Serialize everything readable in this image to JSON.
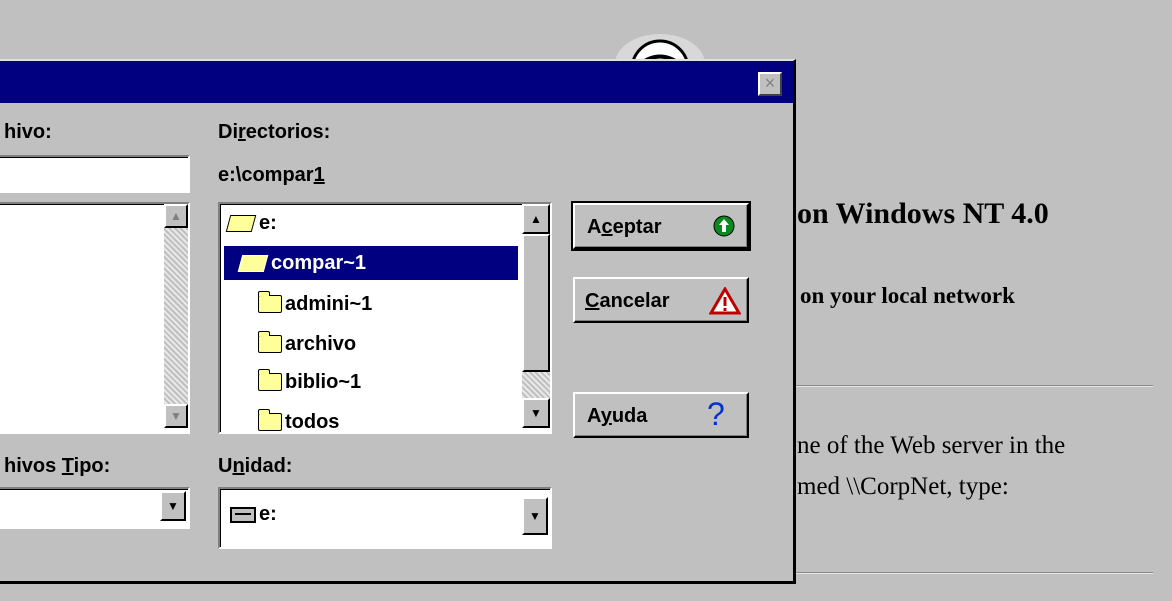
{
  "background": {
    "heading1": "on Windows NT 4.0",
    "heading2": "on your local network",
    "body_line1": "ne of the Web server in the",
    "body_line2": "med \\\\CorpNet, type:"
  },
  "dialog": {
    "close_glyph": "×",
    "file_name": {
      "label": "hivo:",
      "value": ""
    },
    "directories": {
      "label_pre": "Di",
      "label_ul": "r",
      "label_post": "ectorios:",
      "path_pre": "e:\\compar",
      "path_ul": "1",
      "items": [
        {
          "label": "e:",
          "selected": false
        },
        {
          "label": "compar~1",
          "selected": true
        },
        {
          "label": "admini~1",
          "selected": false
        },
        {
          "label": "archivo",
          "selected": false
        },
        {
          "label": "biblio~1",
          "selected": false
        },
        {
          "label": "todos",
          "selected": false
        }
      ]
    },
    "file_type": {
      "label_pre": "hivos ",
      "label_ul": "T",
      "label_post": "ipo:"
    },
    "drive": {
      "label_pre": "U",
      "label_ul": "n",
      "label_post": "idad:",
      "value": "e:"
    },
    "buttons": {
      "accept": {
        "pre": "A",
        "ul": "c",
        "post": "eptar"
      },
      "cancel": {
        "pre": "",
        "ul": "C",
        "post": "ancelar"
      },
      "help": {
        "pre": "A",
        "ul": "y",
        "post": "uda",
        "icon": "?"
      }
    },
    "arrows": {
      "up": "▲",
      "down": "▼"
    }
  }
}
